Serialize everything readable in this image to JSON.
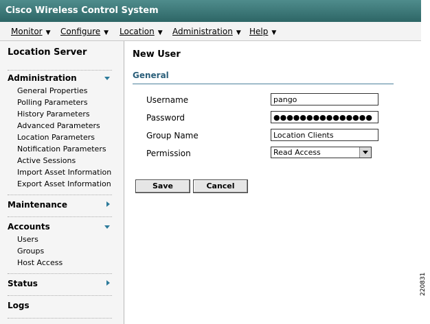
{
  "app": {
    "title": "Cisco Wireless Control System"
  },
  "menu": [
    {
      "label": "Monitor"
    },
    {
      "label": "Configure"
    },
    {
      "label": "Location"
    },
    {
      "label": "Administration"
    },
    {
      "label": "Help"
    }
  ],
  "sidebar": {
    "title": "Location Server",
    "administration": {
      "header": "Administration",
      "items": [
        "General Properties",
        "Polling Parameters",
        "History Parameters",
        "Advanced Parameters",
        "Location Parameters",
        "Notification Parameters",
        "Active Sessions",
        "Import Asset Information",
        "Export Asset Information"
      ]
    },
    "maintenance": {
      "header": "Maintenance"
    },
    "accounts": {
      "header": "Accounts",
      "items": [
        "Users",
        "Groups",
        "Host Access"
      ]
    },
    "status": {
      "header": "Status"
    },
    "logs": {
      "header": "Logs"
    }
  },
  "main": {
    "page_title": "New  User",
    "section_title": "General",
    "form": {
      "username_label": "Username",
      "username_value": "pango",
      "password_label": "Password",
      "password_value": "●●●●●●●●●●●●●●●",
      "group_label": "Group Name",
      "group_value": "Location Clients",
      "permission_label": "Permission",
      "permission_value": "Read Access"
    },
    "buttons": {
      "save": "Save",
      "cancel": "Cancel"
    }
  },
  "figure_id": "220831"
}
